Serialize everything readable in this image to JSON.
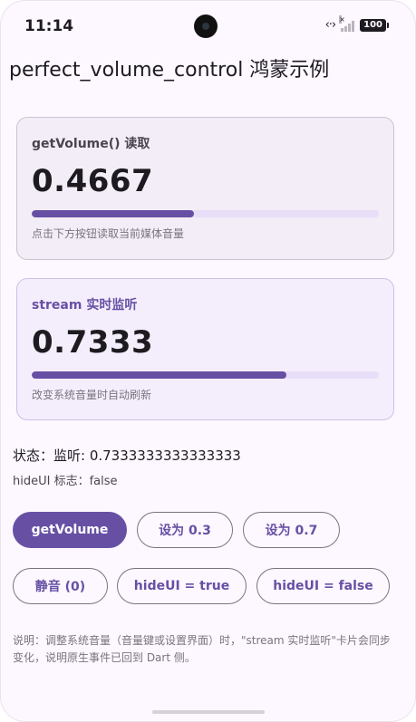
{
  "status_bar": {
    "time": "11:14",
    "battery": "100"
  },
  "app": {
    "title": "perfect_volume_control 鸿蒙示例"
  },
  "cards": [
    {
      "label": "getVolume() 读取",
      "value": "0.4667",
      "level": 0.4667,
      "hint": "点击下方按钮读取当前媒体音量"
    },
    {
      "label": "stream 实时监听",
      "value": "0.7333",
      "level": 0.7333,
      "hint": "改变系统音量时自动刷新"
    }
  ],
  "status_text": "状态：监听: 0.7333333333333333",
  "hideui_text": "hideUI 标志：false",
  "buttons": {
    "get_volume": "getVolume",
    "set_03": "设为 0.3",
    "set_07": "设为 0.7",
    "mute": "静音 (0)",
    "hideui_true": "hideUI = true",
    "hideui_false": "hideUI = false"
  },
  "note": "说明：调整系统音量（音量键或设置界面）时，\"stream 实时监听\"卡片会同步变化，说明原生事件已回到 Dart 侧。",
  "colors": {
    "primary": "#6750a4",
    "track": "#e8def8",
    "background": "#fdf7ff"
  }
}
